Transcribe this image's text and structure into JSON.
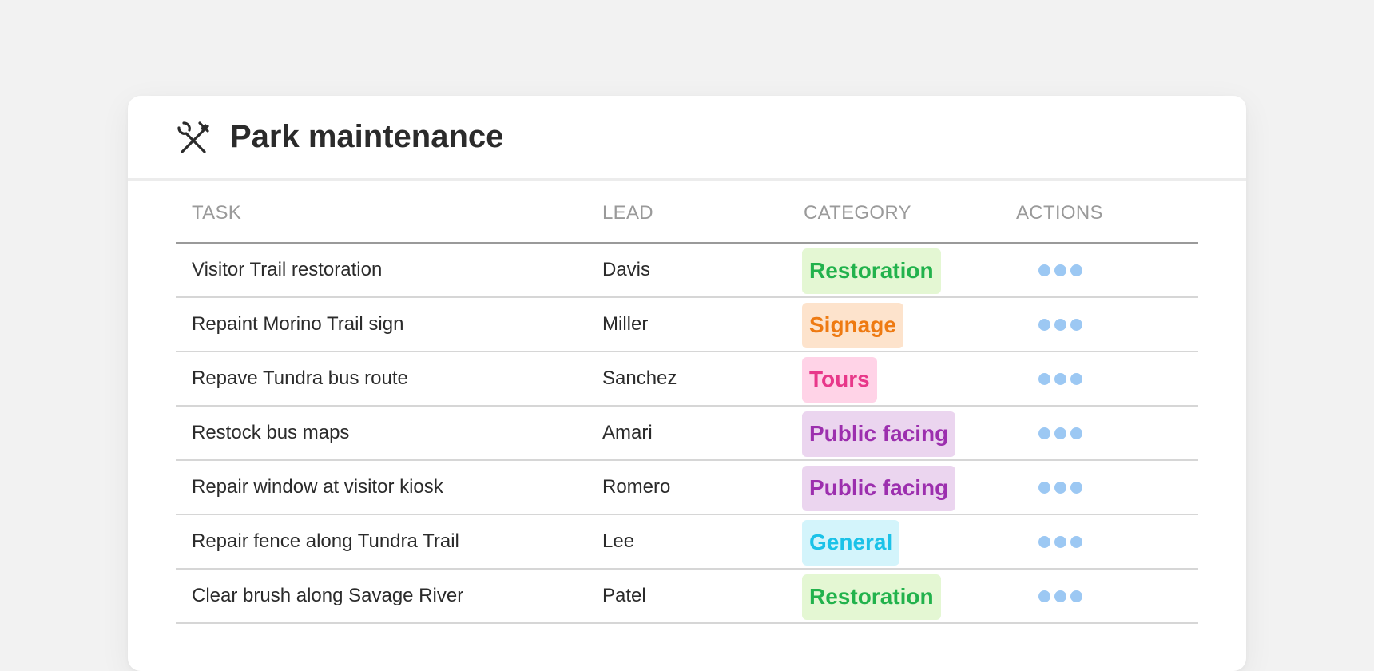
{
  "header": {
    "title": "Park maintenance",
    "icon": "tools-icon"
  },
  "table": {
    "columns": [
      "TASK",
      "LEAD",
      "CATEGORY",
      "ACTIONS"
    ],
    "rows": [
      {
        "task": "Visitor Trail restoration",
        "lead": "Davis",
        "category": "Restoration",
        "category_color": "#22b24c",
        "category_bg": "#e4f7d3"
      },
      {
        "task": "Repaint Morino Trail sign",
        "lead": "Miller",
        "category": "Signage",
        "category_color": "#ee7a12",
        "category_bg": "#fde3cc"
      },
      {
        "task": "Repave Tundra bus route",
        "lead": "Sanchez",
        "category": "Tours",
        "category_color": "#e8388a",
        "category_bg": "#ffd3e7"
      },
      {
        "task": "Restock bus maps",
        "lead": "Amari",
        "category": "Public facing",
        "category_color": "#9c2fae",
        "category_bg": "#ebd5ef"
      },
      {
        "task": "Repair window at visitor kiosk",
        "lead": "Romero",
        "category": "Public facing",
        "category_color": "#9c2fae",
        "category_bg": "#ebd5ef"
      },
      {
        "task": "Repair fence along Tundra Trail",
        "lead": "Lee",
        "category": "General",
        "category_color": "#1bc2e8",
        "category_bg": "#d3f4fb"
      },
      {
        "task": "Clear brush along Savage River",
        "lead": "Patel",
        "category": "Restoration",
        "category_color": "#22b24c",
        "category_bg": "#e4f7d3"
      }
    ],
    "action_icon": "more-options-icon",
    "action_color": "#9cc8f3"
  }
}
